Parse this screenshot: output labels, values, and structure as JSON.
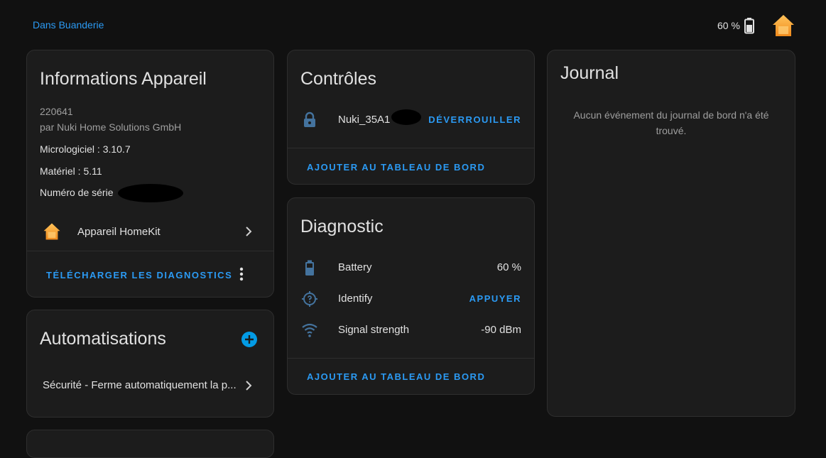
{
  "header": {
    "area_link": "Dans Buanderie",
    "battery": "60 %"
  },
  "device_info": {
    "title": "Informations Appareil",
    "model": "220641",
    "manufacturer": "par Nuki Home Solutions GmbH",
    "firmware": "Micrologiciel : 3.10.7",
    "hardware": "Matériel : 5.11",
    "serial_label": "Numéro de série",
    "homekit_label": "Appareil HomeKit",
    "download_diagnostics": "TÉLÉCHARGER LES DIAGNOSTICS"
  },
  "automations": {
    "title": "Automatisations",
    "items": [
      {
        "label": "Sécurité - Ferme automatiquement la p..."
      }
    ]
  },
  "controls": {
    "title": "Contrôles",
    "lock_name": "Nuki_35A1",
    "unlock_label": "DÉVERROUILLER",
    "add_dashboard": "AJOUTER AU TABLEAU DE BORD"
  },
  "diagnostic": {
    "title": "Diagnostic",
    "rows": [
      {
        "label": "Battery",
        "value": "60 %"
      },
      {
        "label": "Identify",
        "value": "APPUYER"
      },
      {
        "label": "Signal strength",
        "value": "-90 dBm"
      }
    ],
    "add_dashboard": "AJOUTER AU TABLEAU DE BORD"
  },
  "logbook": {
    "title": "Journal",
    "empty_text": "Aucun événement du journal de bord n'a été trouvé."
  },
  "colors": {
    "accent": "#2b9af3",
    "icon_blue": "#44739e",
    "background": "#111111",
    "card": "#1c1c1c",
    "homekit_orange": "#f5a623"
  }
}
